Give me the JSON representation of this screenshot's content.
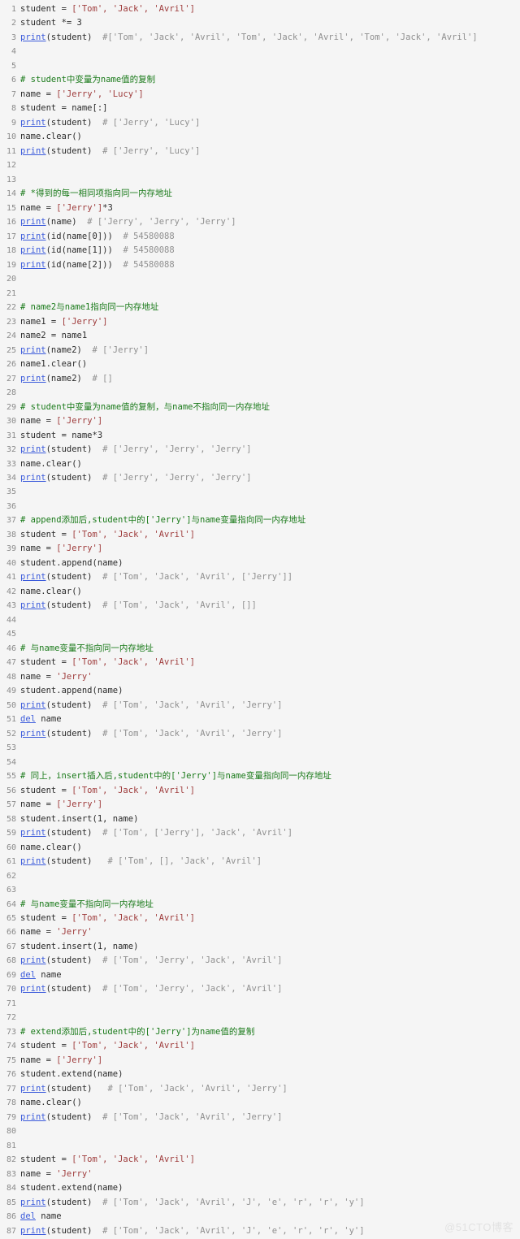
{
  "editor": {
    "background_color": "#f5f5f5",
    "line_number_color": "#8a8a8a",
    "colors": {
      "plain": "#2b2b2b",
      "string": "#9e3b3b",
      "comment": "#1a7a1a",
      "comment_gray": "#8f8f8f",
      "comment_string": "#a87a7a",
      "function": "#3b5bdb"
    },
    "total_lines": 87,
    "language": "python"
  },
  "watermark": {
    "text": "@51CTO博客"
  },
  "lines": [
    {
      "n": "1",
      "tokens": [
        {
          "t": "student = ",
          "c": "plain"
        },
        {
          "t": "['Tom', 'Jack', 'Avril']",
          "c": "str"
        }
      ]
    },
    {
      "n": "2",
      "tokens": [
        {
          "t": "student *= 3",
          "c": "plain"
        }
      ]
    },
    {
      "n": "3",
      "tokens": [
        {
          "t": "print",
          "c": "fn"
        },
        {
          "t": "(student)  ",
          "c": "plain"
        },
        {
          "t": "#['Tom', 'Jack', 'Avril', 'Tom', 'Jack', 'Avril', 'Tom', 'Jack', 'Avril']",
          "c": "cmt-gray"
        }
      ]
    },
    {
      "n": "4",
      "tokens": []
    },
    {
      "n": "5",
      "tokens": []
    },
    {
      "n": "6",
      "tokens": [
        {
          "t": "# student中变量为name值的复制",
          "c": "comment"
        }
      ]
    },
    {
      "n": "7",
      "tokens": [
        {
          "t": "name = ",
          "c": "plain"
        },
        {
          "t": "['Jerry', 'Lucy']",
          "c": "str"
        }
      ]
    },
    {
      "n": "8",
      "tokens": [
        {
          "t": "student = name[:]",
          "c": "plain"
        }
      ]
    },
    {
      "n": "9",
      "tokens": [
        {
          "t": "print",
          "c": "fn"
        },
        {
          "t": "(student)  ",
          "c": "plain"
        },
        {
          "t": "# ['Jerry', 'Lucy']",
          "c": "cmt-gray"
        }
      ]
    },
    {
      "n": "10",
      "tokens": [
        {
          "t": "name.clear()",
          "c": "plain"
        }
      ]
    },
    {
      "n": "11",
      "tokens": [
        {
          "t": "print",
          "c": "fn"
        },
        {
          "t": "(student)  ",
          "c": "plain"
        },
        {
          "t": "# ['Jerry', 'Lucy']",
          "c": "cmt-gray"
        }
      ]
    },
    {
      "n": "12",
      "tokens": []
    },
    {
      "n": "13",
      "tokens": []
    },
    {
      "n": "14",
      "tokens": [
        {
          "t": "# *得到的每一相同项指向同一内存地址",
          "c": "comment"
        }
      ]
    },
    {
      "n": "15",
      "tokens": [
        {
          "t": "name = ",
          "c": "plain"
        },
        {
          "t": "['Jerry']",
          "c": "str"
        },
        {
          "t": "*3",
          "c": "plain"
        }
      ]
    },
    {
      "n": "16",
      "tokens": [
        {
          "t": "print",
          "c": "fn"
        },
        {
          "t": "(name)  ",
          "c": "plain"
        },
        {
          "t": "# ['Jerry', 'Jerry', 'Jerry']",
          "c": "cmt-gray"
        }
      ]
    },
    {
      "n": "17",
      "tokens": [
        {
          "t": "print",
          "c": "fn"
        },
        {
          "t": "(id(name[0]))  ",
          "c": "plain"
        },
        {
          "t": "# 54580088",
          "c": "cmt-gray"
        }
      ]
    },
    {
      "n": "18",
      "tokens": [
        {
          "t": "print",
          "c": "fn"
        },
        {
          "t": "(id(name[1]))  ",
          "c": "plain"
        },
        {
          "t": "# 54580088",
          "c": "cmt-gray"
        }
      ]
    },
    {
      "n": "19",
      "tokens": [
        {
          "t": "print",
          "c": "fn"
        },
        {
          "t": "(id(name[2]))  ",
          "c": "plain"
        },
        {
          "t": "# 54580088",
          "c": "cmt-gray"
        }
      ]
    },
    {
      "n": "20",
      "tokens": []
    },
    {
      "n": "21",
      "tokens": []
    },
    {
      "n": "22",
      "tokens": [
        {
          "t": "# name2与name1指向同一内存地址",
          "c": "comment"
        }
      ]
    },
    {
      "n": "23",
      "tokens": [
        {
          "t": "name1 = ",
          "c": "plain"
        },
        {
          "t": "['Jerry']",
          "c": "str"
        }
      ]
    },
    {
      "n": "24",
      "tokens": [
        {
          "t": "name2 = name1",
          "c": "plain"
        }
      ]
    },
    {
      "n": "25",
      "tokens": [
        {
          "t": "print",
          "c": "fn"
        },
        {
          "t": "(name2)  ",
          "c": "plain"
        },
        {
          "t": "# ['Jerry']",
          "c": "cmt-gray"
        }
      ]
    },
    {
      "n": "26",
      "tokens": [
        {
          "t": "name1.clear()",
          "c": "plain"
        }
      ]
    },
    {
      "n": "27",
      "tokens": [
        {
          "t": "print",
          "c": "fn"
        },
        {
          "t": "(name2)  ",
          "c": "plain"
        },
        {
          "t": "# []",
          "c": "cmt-gray"
        }
      ]
    },
    {
      "n": "28",
      "tokens": []
    },
    {
      "n": "29",
      "tokens": [
        {
          "t": "# student中变量为name值的复制，与name不指向同一内存地址",
          "c": "comment"
        }
      ]
    },
    {
      "n": "30",
      "tokens": [
        {
          "t": "name = ",
          "c": "plain"
        },
        {
          "t": "['Jerry']",
          "c": "str"
        }
      ]
    },
    {
      "n": "31",
      "tokens": [
        {
          "t": "student = name*3",
          "c": "plain"
        }
      ]
    },
    {
      "n": "32",
      "tokens": [
        {
          "t": "print",
          "c": "fn"
        },
        {
          "t": "(student)  ",
          "c": "plain"
        },
        {
          "t": "# ['Jerry', 'Jerry', 'Jerry']",
          "c": "cmt-gray"
        }
      ]
    },
    {
      "n": "33",
      "tokens": [
        {
          "t": "name.clear()",
          "c": "plain"
        }
      ]
    },
    {
      "n": "34",
      "tokens": [
        {
          "t": "print",
          "c": "fn"
        },
        {
          "t": "(student)  ",
          "c": "plain"
        },
        {
          "t": "# ['Jerry', 'Jerry', 'Jerry']",
          "c": "cmt-gray"
        }
      ]
    },
    {
      "n": "35",
      "tokens": []
    },
    {
      "n": "36",
      "tokens": []
    },
    {
      "n": "37",
      "tokens": [
        {
          "t": "# append添加后,student中的['Jerry']与name变量指向同一内存地址",
          "c": "comment"
        }
      ]
    },
    {
      "n": "38",
      "tokens": [
        {
          "t": "student = ",
          "c": "plain"
        },
        {
          "t": "['Tom', 'Jack', 'Avril']",
          "c": "str"
        }
      ]
    },
    {
      "n": "39",
      "tokens": [
        {
          "t": "name = ",
          "c": "plain"
        },
        {
          "t": "['Jerry']",
          "c": "str"
        }
      ]
    },
    {
      "n": "40",
      "tokens": [
        {
          "t": "student.append(name)",
          "c": "plain"
        }
      ]
    },
    {
      "n": "41",
      "tokens": [
        {
          "t": "print",
          "c": "fn"
        },
        {
          "t": "(student)  ",
          "c": "plain"
        },
        {
          "t": "# ['Tom', 'Jack', 'Avril', ['Jerry']]",
          "c": "cmt-gray"
        }
      ]
    },
    {
      "n": "42",
      "tokens": [
        {
          "t": "name.clear()",
          "c": "plain"
        }
      ]
    },
    {
      "n": "43",
      "tokens": [
        {
          "t": "print",
          "c": "fn"
        },
        {
          "t": "(student)  ",
          "c": "plain"
        },
        {
          "t": "# ['Tom', 'Jack', 'Avril', []]",
          "c": "cmt-gray"
        }
      ]
    },
    {
      "n": "44",
      "tokens": []
    },
    {
      "n": "45",
      "tokens": []
    },
    {
      "n": "46",
      "tokens": [
        {
          "t": "# 与name变量不指向同一内存地址",
          "c": "comment"
        }
      ]
    },
    {
      "n": "47",
      "tokens": [
        {
          "t": "student = ",
          "c": "plain"
        },
        {
          "t": "['Tom', 'Jack', 'Avril']",
          "c": "str"
        }
      ]
    },
    {
      "n": "48",
      "tokens": [
        {
          "t": "name = ",
          "c": "plain"
        },
        {
          "t": "'Jerry'",
          "c": "str"
        }
      ]
    },
    {
      "n": "49",
      "tokens": [
        {
          "t": "student.append(name)",
          "c": "plain"
        }
      ]
    },
    {
      "n": "50",
      "tokens": [
        {
          "t": "print",
          "c": "fn"
        },
        {
          "t": "(student)  ",
          "c": "plain"
        },
        {
          "t": "# ['Tom', 'Jack', 'Avril', 'Jerry']",
          "c": "cmt-gray"
        }
      ]
    },
    {
      "n": "51",
      "tokens": [
        {
          "t": "del",
          "c": "kw"
        },
        {
          "t": " name",
          "c": "plain"
        }
      ]
    },
    {
      "n": "52",
      "tokens": [
        {
          "t": "print",
          "c": "fn"
        },
        {
          "t": "(student)  ",
          "c": "plain"
        },
        {
          "t": "# ['Tom', 'Jack', 'Avril', 'Jerry']",
          "c": "cmt-gray"
        }
      ]
    },
    {
      "n": "53",
      "tokens": []
    },
    {
      "n": "54",
      "tokens": []
    },
    {
      "n": "55",
      "tokens": [
        {
          "t": "# 同上，insert插入后,student中的['Jerry']与name变量指向同一内存地址",
          "c": "comment"
        }
      ]
    },
    {
      "n": "56",
      "tokens": [
        {
          "t": "student = ",
          "c": "plain"
        },
        {
          "t": "['Tom', 'Jack', 'Avril']",
          "c": "str"
        }
      ]
    },
    {
      "n": "57",
      "tokens": [
        {
          "t": "name = ",
          "c": "plain"
        },
        {
          "t": "['Jerry']",
          "c": "str"
        }
      ]
    },
    {
      "n": "58",
      "tokens": [
        {
          "t": "student.insert(1, name)",
          "c": "plain"
        }
      ]
    },
    {
      "n": "59",
      "tokens": [
        {
          "t": "print",
          "c": "fn"
        },
        {
          "t": "(student)  ",
          "c": "plain"
        },
        {
          "t": "# ['Tom', ['Jerry'], 'Jack', 'Avril']",
          "c": "cmt-gray"
        }
      ]
    },
    {
      "n": "60",
      "tokens": [
        {
          "t": "name.clear()",
          "c": "plain"
        }
      ]
    },
    {
      "n": "61",
      "tokens": [
        {
          "t": "print",
          "c": "fn"
        },
        {
          "t": "(student)   ",
          "c": "plain"
        },
        {
          "t": "# ['Tom', [], 'Jack', 'Avril']",
          "c": "cmt-gray"
        }
      ]
    },
    {
      "n": "62",
      "tokens": []
    },
    {
      "n": "63",
      "tokens": []
    },
    {
      "n": "64",
      "tokens": [
        {
          "t": "# 与name变量不指向同一内存地址",
          "c": "comment"
        }
      ]
    },
    {
      "n": "65",
      "tokens": [
        {
          "t": "student = ",
          "c": "plain"
        },
        {
          "t": "['Tom', 'Jack', 'Avril']",
          "c": "str"
        }
      ]
    },
    {
      "n": "66",
      "tokens": [
        {
          "t": "name = ",
          "c": "plain"
        },
        {
          "t": "'Jerry'",
          "c": "str"
        }
      ]
    },
    {
      "n": "67",
      "tokens": [
        {
          "t": "student.insert(1, name)",
          "c": "plain"
        }
      ]
    },
    {
      "n": "68",
      "tokens": [
        {
          "t": "print",
          "c": "fn"
        },
        {
          "t": "(student)  ",
          "c": "plain"
        },
        {
          "t": "# ['Tom', 'Jerry', 'Jack', 'Avril']",
          "c": "cmt-gray"
        }
      ]
    },
    {
      "n": "69",
      "tokens": [
        {
          "t": "del",
          "c": "kw"
        },
        {
          "t": " name",
          "c": "plain"
        }
      ]
    },
    {
      "n": "70",
      "tokens": [
        {
          "t": "print",
          "c": "fn"
        },
        {
          "t": "(student)  ",
          "c": "plain"
        },
        {
          "t": "# ['Tom', 'Jerry', 'Jack', 'Avril']",
          "c": "cmt-gray"
        }
      ]
    },
    {
      "n": "71",
      "tokens": []
    },
    {
      "n": "72",
      "tokens": []
    },
    {
      "n": "73",
      "tokens": [
        {
          "t": "# extend添加后,student中的['Jerry']为name值的复制",
          "c": "comment"
        }
      ]
    },
    {
      "n": "74",
      "tokens": [
        {
          "t": "student = ",
          "c": "plain"
        },
        {
          "t": "['Tom', 'Jack', 'Avril']",
          "c": "str"
        }
      ]
    },
    {
      "n": "75",
      "tokens": [
        {
          "t": "name = ",
          "c": "plain"
        },
        {
          "t": "['Jerry']",
          "c": "str"
        }
      ]
    },
    {
      "n": "76",
      "tokens": [
        {
          "t": "student.extend(name)",
          "c": "plain"
        }
      ]
    },
    {
      "n": "77",
      "tokens": [
        {
          "t": "print",
          "c": "fn"
        },
        {
          "t": "(student)   ",
          "c": "plain"
        },
        {
          "t": "# ['Tom', 'Jack', 'Avril', 'Jerry']",
          "c": "cmt-gray"
        }
      ]
    },
    {
      "n": "78",
      "tokens": [
        {
          "t": "name.clear()",
          "c": "plain"
        }
      ]
    },
    {
      "n": "79",
      "tokens": [
        {
          "t": "print",
          "c": "fn"
        },
        {
          "t": "(student)  ",
          "c": "plain"
        },
        {
          "t": "# ['Tom', 'Jack', 'Avril', 'Jerry']",
          "c": "cmt-gray"
        }
      ]
    },
    {
      "n": "80",
      "tokens": []
    },
    {
      "n": "81",
      "tokens": []
    },
    {
      "n": "82",
      "tokens": [
        {
          "t": "student = ",
          "c": "plain"
        },
        {
          "t": "['Tom', 'Jack', 'Avril']",
          "c": "str"
        }
      ]
    },
    {
      "n": "83",
      "tokens": [
        {
          "t": "name = ",
          "c": "plain"
        },
        {
          "t": "'Jerry'",
          "c": "str"
        }
      ]
    },
    {
      "n": "84",
      "tokens": [
        {
          "t": "student.extend(name)",
          "c": "plain"
        }
      ]
    },
    {
      "n": "85",
      "tokens": [
        {
          "t": "print",
          "c": "fn"
        },
        {
          "t": "(student)  ",
          "c": "plain"
        },
        {
          "t": "# ['Tom', 'Jack', 'Avril', 'J', 'e', 'r', 'r', 'y']",
          "c": "cmt-gray"
        }
      ]
    },
    {
      "n": "86",
      "tokens": [
        {
          "t": "del",
          "c": "kw"
        },
        {
          "t": " name",
          "c": "plain"
        }
      ]
    },
    {
      "n": "87",
      "tokens": [
        {
          "t": "print",
          "c": "fn"
        },
        {
          "t": "(student)  ",
          "c": "plain"
        },
        {
          "t": "# ['Tom', 'Jack', 'Avril', 'J', 'e', 'r', 'r', 'y']",
          "c": "cmt-gray"
        }
      ]
    }
  ]
}
